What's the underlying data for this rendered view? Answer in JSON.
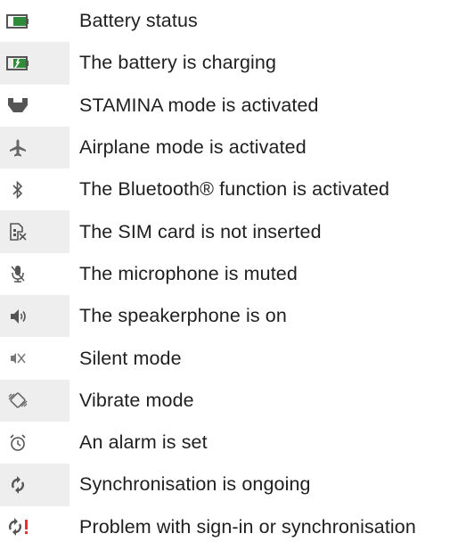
{
  "colors": {
    "icon_grey": "#555555",
    "battery_green": "#2e8b3a",
    "alert_red": "#e53030",
    "shade": "#eeeeee",
    "text": "#1f1f1f"
  },
  "status_icons": [
    {
      "icon": "battery-status-icon",
      "label": "Battery status"
    },
    {
      "icon": "battery-charging-icon",
      "label": "The battery is charging"
    },
    {
      "icon": "stamina-mode-icon",
      "label": "STAMINA mode is activated"
    },
    {
      "icon": "airplane-mode-icon",
      "label": "Airplane mode is activated"
    },
    {
      "icon": "bluetooth-icon",
      "label": "The Bluetooth® function is activated"
    },
    {
      "icon": "sim-card-missing-icon",
      "label": "The SIM card is not inserted"
    },
    {
      "icon": "microphone-muted-icon",
      "label": "The microphone is muted"
    },
    {
      "icon": "speakerphone-icon",
      "label": "The speakerphone is on"
    },
    {
      "icon": "silent-mode-icon",
      "label": "Silent mode"
    },
    {
      "icon": "vibrate-mode-icon",
      "label": "Vibrate mode"
    },
    {
      "icon": "alarm-icon",
      "label": "An alarm is set"
    },
    {
      "icon": "sync-icon",
      "label": "Synchronisation is ongoing"
    },
    {
      "icon": "sync-problem-icon",
      "label": "Problem with sign-in or synchronisation"
    }
  ]
}
